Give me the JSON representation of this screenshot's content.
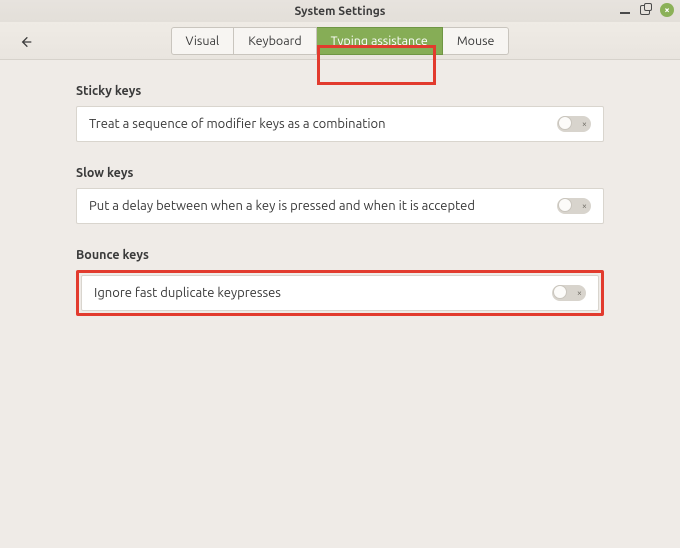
{
  "window": {
    "title": "System Settings"
  },
  "tabs": {
    "items": [
      {
        "label": "Visual",
        "active": false
      },
      {
        "label": "Keyboard",
        "active": false
      },
      {
        "label": "Typing assistance",
        "active": true
      },
      {
        "label": "Mouse",
        "active": false
      }
    ]
  },
  "sections": {
    "sticky": {
      "title": "Sticky keys",
      "row_label": "Treat a sequence of modifier keys as a combination",
      "toggle_on": false
    },
    "slow": {
      "title": "Slow keys",
      "row_label": "Put a delay between when a key is pressed and when it is accepted",
      "toggle_on": false
    },
    "bounce": {
      "title": "Bounce keys",
      "row_label": "Ignore fast duplicate keypresses",
      "toggle_on": false
    }
  },
  "icons": {
    "close_glyph": "×",
    "toggle_off_glyph": "×"
  }
}
